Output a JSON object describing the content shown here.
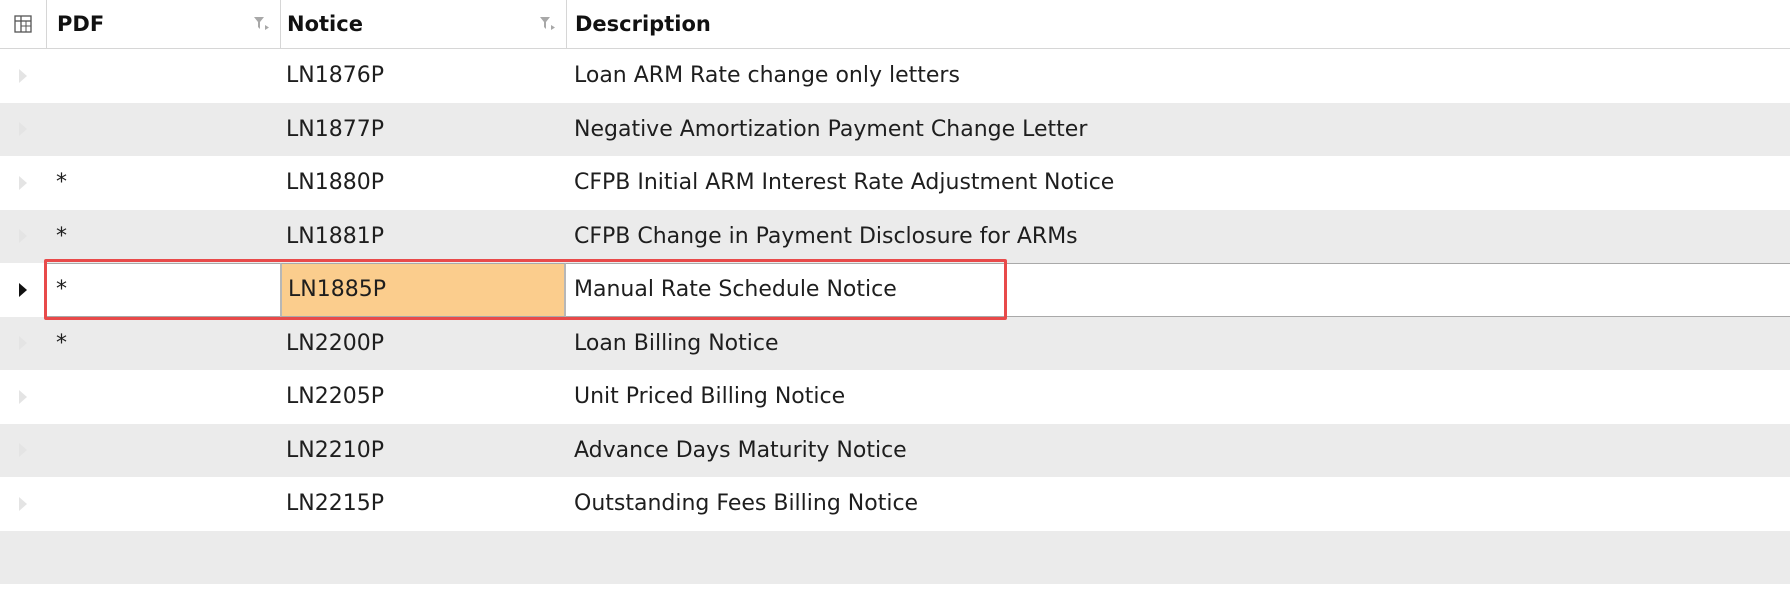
{
  "columns": {
    "pdf": "PDF",
    "notice": "Notice",
    "description": "Description"
  },
  "icons": {
    "column_chooser": "column-chooser-icon",
    "filter": "filter-icon",
    "row_indicator": "row-indicator-icon"
  },
  "colors": {
    "selected_cell": "#fbcd8d",
    "highlight_border": "#e84a4a",
    "alt_row": "#ebebeb"
  },
  "rows": [
    {
      "pdf": "",
      "notice": "LN1876P",
      "description": "Loan ARM Rate change only letters"
    },
    {
      "pdf": "",
      "notice": "LN1877P",
      "description": "Negative Amortization Payment Change Letter"
    },
    {
      "pdf": "*",
      "notice": "LN1880P",
      "description": "CFPB Initial ARM Interest Rate Adjustment Notice"
    },
    {
      "pdf": "*",
      "notice": "LN1881P",
      "description": "CFPB Change in Payment Disclosure for ARMs"
    },
    {
      "pdf": "*",
      "notice": "LN1885P",
      "description": "Manual Rate Schedule Notice",
      "selected": true
    },
    {
      "pdf": "*",
      "notice": "LN2200P",
      "description": "Loan Billing Notice"
    },
    {
      "pdf": "",
      "notice": "LN2205P",
      "description": "Unit Priced Billing Notice"
    },
    {
      "pdf": "",
      "notice": "LN2210P",
      "description": "Advance Days Maturity Notice"
    },
    {
      "pdf": "",
      "notice": "LN2215P",
      "description": "Outstanding Fees Billing Notice"
    },
    {
      "pdf": "",
      "notice": "",
      "description": ""
    }
  ]
}
